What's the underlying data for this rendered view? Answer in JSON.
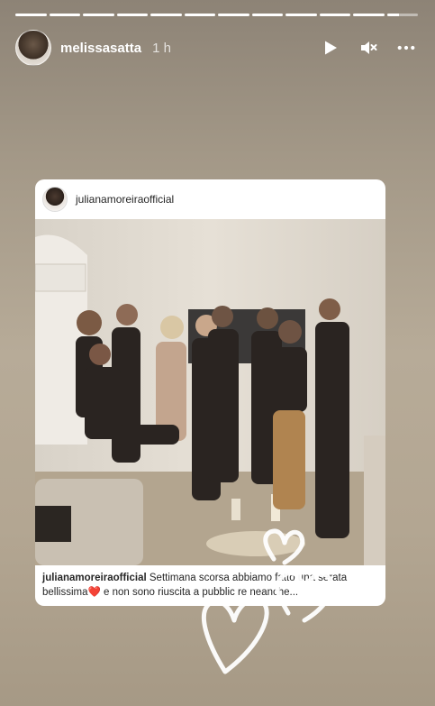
{
  "story": {
    "segments_total": 12,
    "segments_viewed": 12,
    "current_segment_progress": 0.4
  },
  "header": {
    "username": "melissasatta",
    "time": "1 h",
    "icons": {
      "play": "play-icon",
      "mute": "mute-icon",
      "more": "more-icon"
    }
  },
  "post": {
    "username": "julianamoreiraofficial",
    "caption_user": "julianamoreiraofficial",
    "caption_text_1": " Settimana scorsa abbiamo fatto una serata bellissima",
    "caption_emoji": "❤️",
    "caption_text_2": " e non sono riuscita a pubblic  re neanche..."
  },
  "sticker": {
    "icon": "hearts-sticker"
  },
  "colors": {
    "heart": "#e0245e",
    "text": "#262626"
  }
}
